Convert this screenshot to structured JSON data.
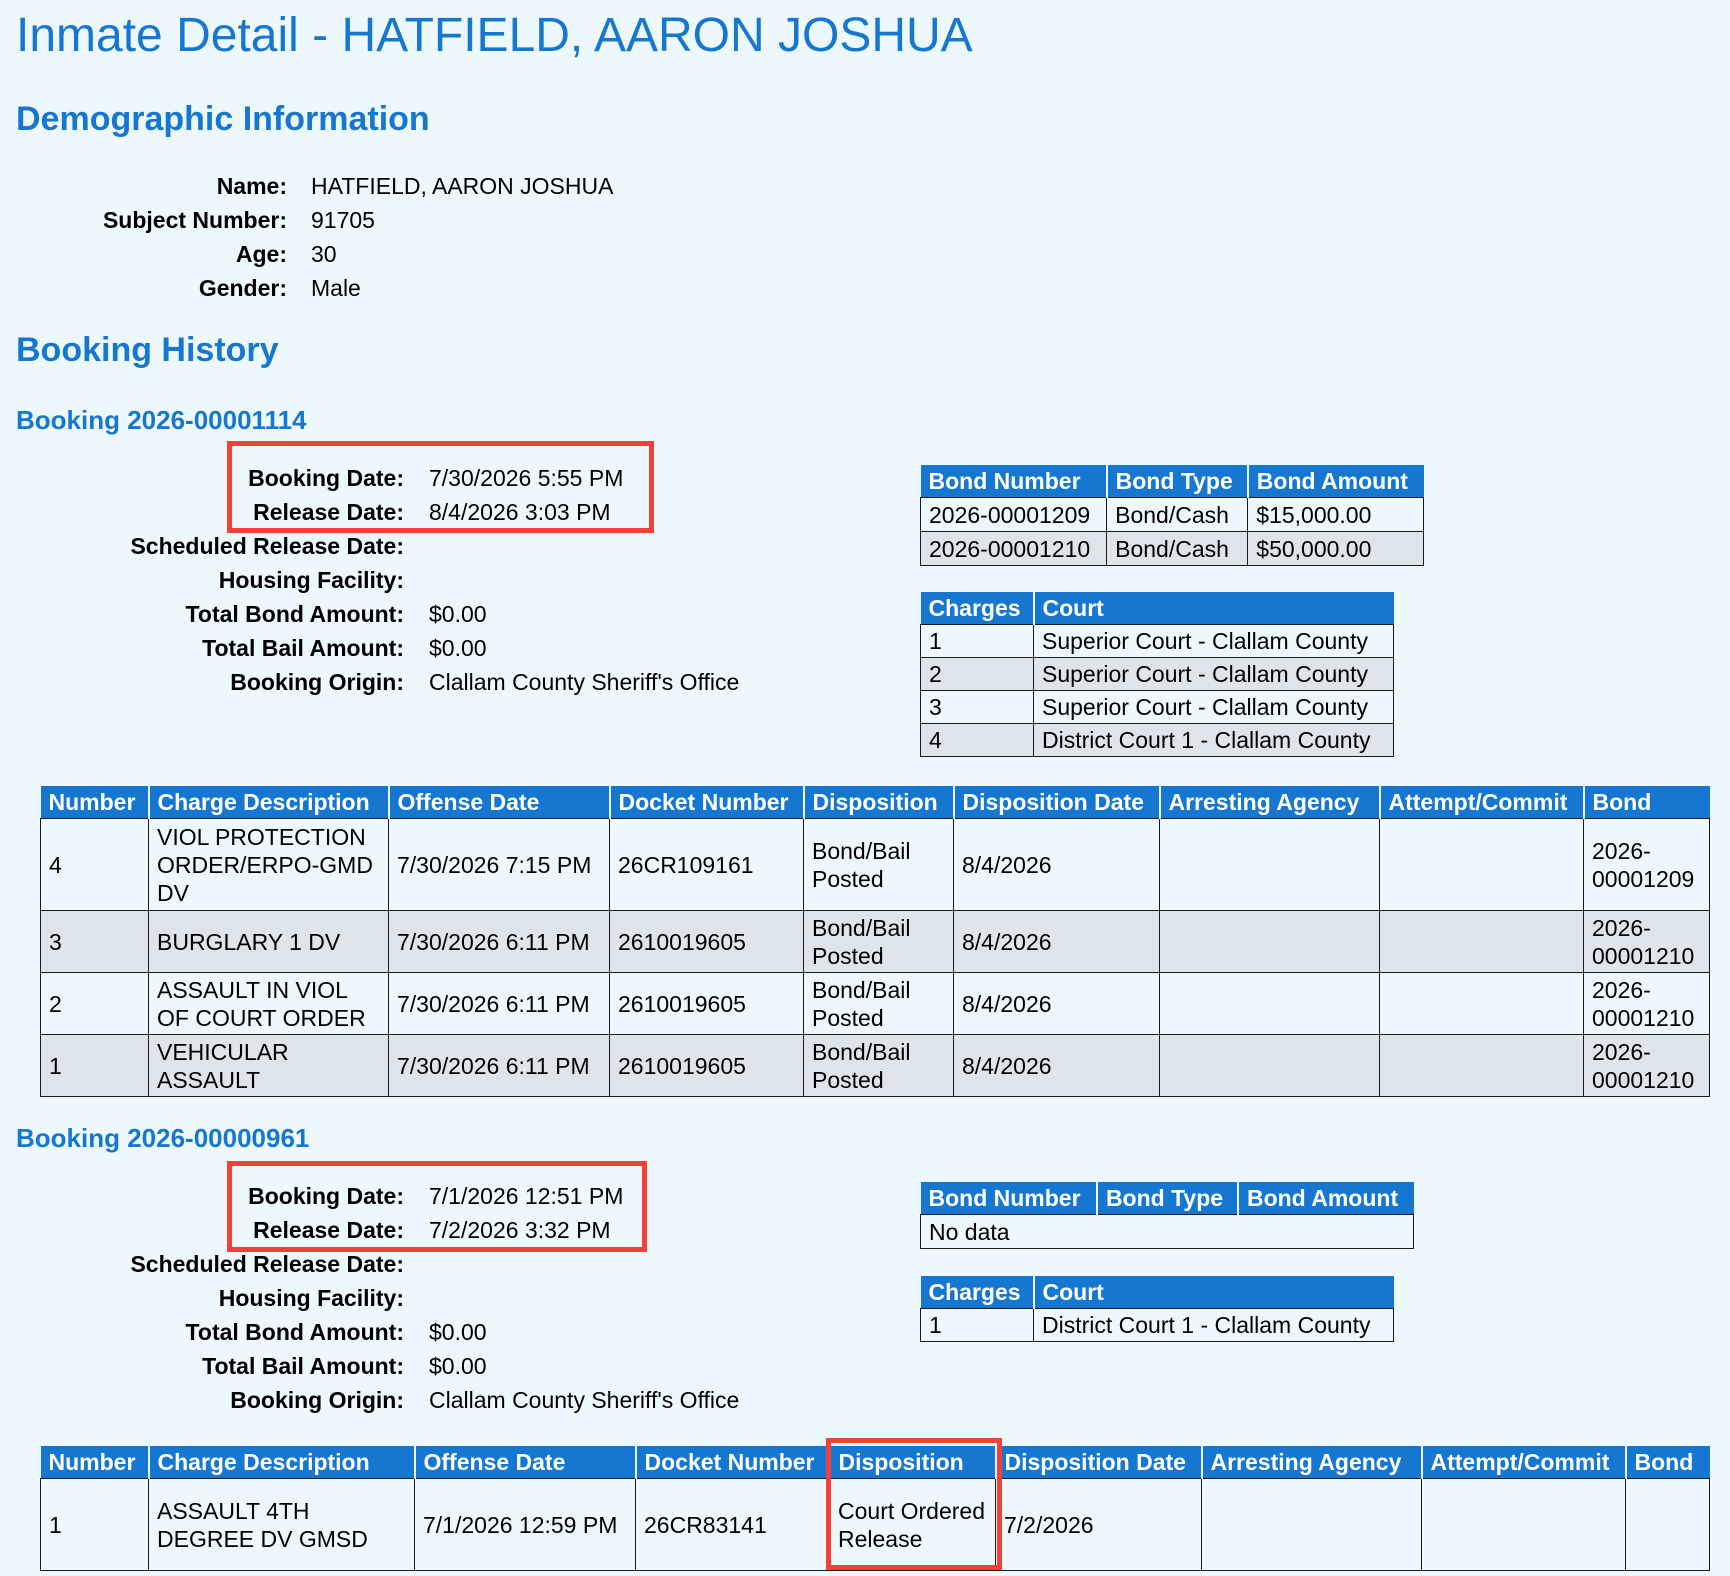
{
  "page_title": "Inmate Detail - HATFIELD, AARON JOSHUA",
  "demographics": {
    "heading": "Demographic Information",
    "fields": [
      {
        "label": "Name:",
        "value": "HATFIELD, AARON JOSHUA"
      },
      {
        "label": "Subject Number:",
        "value": "91705"
      },
      {
        "label": "Age:",
        "value": "30"
      },
      {
        "label": "Gender:",
        "value": "Male"
      }
    ]
  },
  "booking_history_heading": "Booking History",
  "bookings": [
    {
      "title": "Booking 2026-00001114",
      "fields": [
        {
          "label": "Booking Date:",
          "value": "7/30/2026 5:55 PM"
        },
        {
          "label": "Release Date:",
          "value": "8/4/2026 3:03 PM"
        },
        {
          "label": "Scheduled Release Date:",
          "value": ""
        },
        {
          "label": "Housing Facility:",
          "value": ""
        },
        {
          "label": "Total Bond Amount:",
          "value": "$0.00"
        },
        {
          "label": "Total Bail Amount:",
          "value": "$0.00"
        },
        {
          "label": "Booking Origin:",
          "value": "Clallam County Sheriff's Office"
        }
      ],
      "bond_table": {
        "headers": [
          "Bond Number",
          "Bond Type",
          "Bond Amount"
        ],
        "rows": [
          [
            "2026-00001209",
            "Bond/Cash",
            "$15,000.00"
          ],
          [
            "2026-00001210",
            "Bond/Cash",
            "$50,000.00"
          ]
        ]
      },
      "court_table": {
        "headers": [
          "Charges",
          "Court"
        ],
        "rows": [
          [
            "1",
            "Superior Court - Clallam County"
          ],
          [
            "2",
            "Superior Court - Clallam County"
          ],
          [
            "3",
            "Superior Court - Clallam County"
          ],
          [
            "4",
            "District Court 1 - Clallam County"
          ]
        ]
      },
      "charges_table": {
        "headers": [
          "Number",
          "Charge Description",
          "Offense Date",
          "Docket Number",
          "Disposition",
          "Disposition Date",
          "Arresting Agency",
          "Attempt/Commit",
          "Bond"
        ],
        "rows": [
          [
            "4",
            "VIOL PROTECTION ORDER/ERPO-GMD DV",
            "7/30/2026 7:15 PM",
            "26CR109161",
            "Bond/Bail Posted",
            "8/4/2026",
            "",
            "",
            "2026-00001209"
          ],
          [
            "3",
            "BURGLARY 1 DV",
            "7/30/2026 6:11 PM",
            "2610019605",
            "Bond/Bail Posted",
            "8/4/2026",
            "",
            "",
            "2026-00001210"
          ],
          [
            "2",
            "ASSAULT IN VIOL OF COURT ORDER",
            "7/30/2026 6:11 PM",
            "2610019605",
            "Bond/Bail Posted",
            "8/4/2026",
            "",
            "",
            "2026-00001210"
          ],
          [
            "1",
            "VEHICULAR ASSAULT",
            "7/30/2026 6:11 PM",
            "2610019605",
            "Bond/Bail Posted",
            "8/4/2026",
            "",
            "",
            "2026-00001210"
          ]
        ]
      }
    },
    {
      "title": "Booking 2026-00000961",
      "fields": [
        {
          "label": "Booking Date:",
          "value": "7/1/2026 12:51 PM"
        },
        {
          "label": "Release Date:",
          "value": "7/2/2026 3:32 PM"
        },
        {
          "label": "Scheduled Release Date:",
          "value": ""
        },
        {
          "label": "Housing Facility:",
          "value": ""
        },
        {
          "label": "Total Bond Amount:",
          "value": "$0.00"
        },
        {
          "label": "Total Bail Amount:",
          "value": "$0.00"
        },
        {
          "label": "Booking Origin:",
          "value": "Clallam County Sheriff's Office"
        }
      ],
      "bond_table": {
        "headers": [
          "Bond Number",
          "Bond Type",
          "Bond Amount"
        ],
        "rows": [
          [
            "No data"
          ]
        ]
      },
      "court_table": {
        "headers": [
          "Charges",
          "Court"
        ],
        "rows": [
          [
            "1",
            "District Court 1 - Clallam County"
          ]
        ]
      },
      "charges_table": {
        "headers": [
          "Number",
          "Charge Description",
          "Offense Date",
          "Docket Number",
          "Disposition",
          "Disposition Date",
          "Arresting Agency",
          "Attempt/Commit",
          "Bond"
        ],
        "rows": [
          [
            "1",
            "ASSAULT 4TH DEGREE DV GMSD",
            "7/1/2026 12:59 PM",
            "26CR83141",
            "Court Ordered Release",
            "7/2/2026",
            "",
            "",
            ""
          ]
        ]
      }
    }
  ],
  "highlight_color": "#f2413a"
}
